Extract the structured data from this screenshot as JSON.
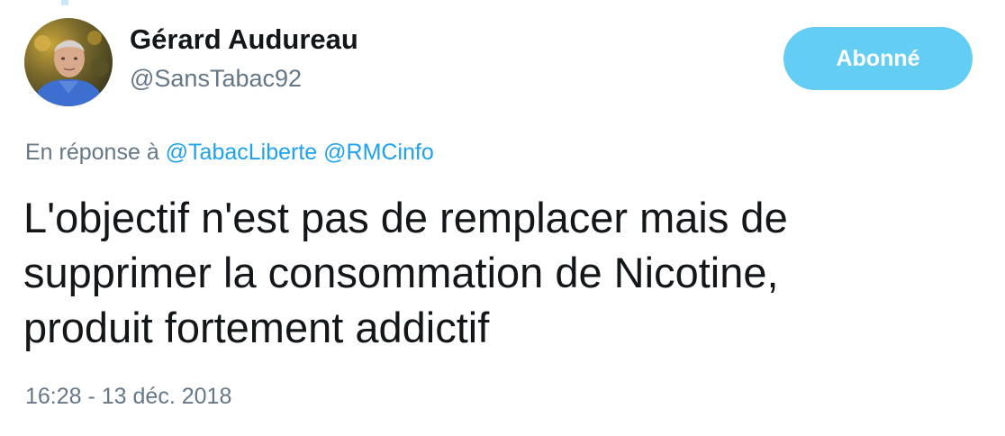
{
  "tweet": {
    "author": {
      "display_name": "Gérard Audureau",
      "handle": "@SansTabac92"
    },
    "follow_button_label": "Abonné",
    "reply_context": {
      "prefix": "En réponse à",
      "mentions": [
        "@TabacLiberte",
        "@RMCinfo"
      ]
    },
    "text_lines": [
      "L'objectif n'est pas de remplacer mais de",
      "supprimer la consommation de Nicotine,",
      "produit fortement addictif"
    ],
    "timestamp": "16:28 - 13 déc. 2018"
  },
  "colors": {
    "follow_button_bg": "#63cdf3",
    "mention": "#1da1f2",
    "secondary_text": "#657786",
    "primary_text": "#14171a"
  }
}
